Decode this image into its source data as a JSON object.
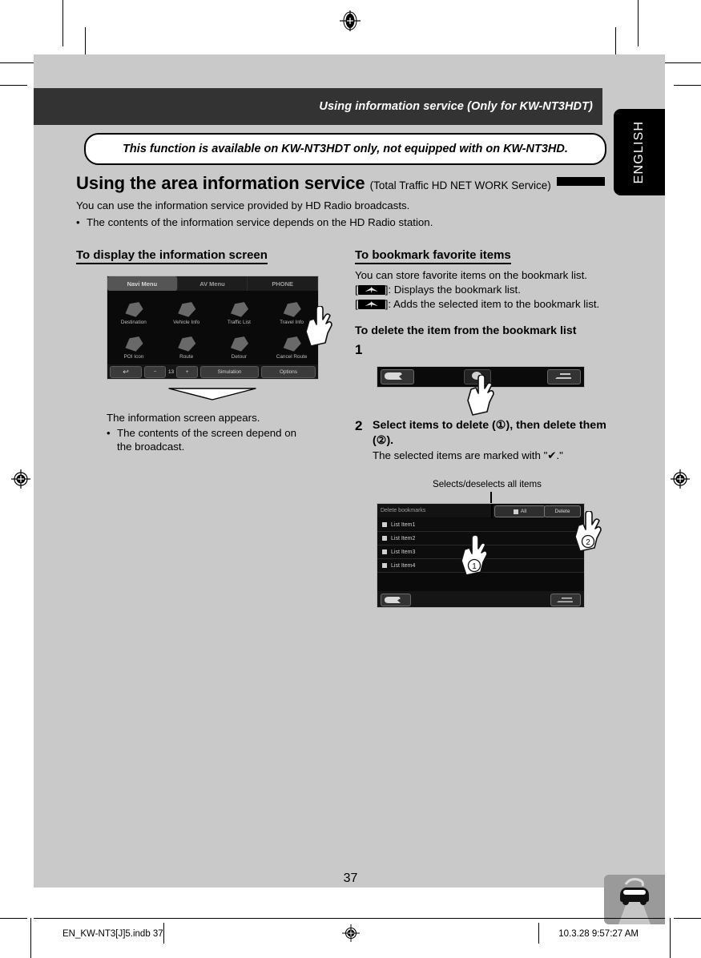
{
  "header": {
    "title": "Using information service (Only for KW-NT3HDT)",
    "side_tab": "ENGLISH"
  },
  "notice": "This function is available on KW-NT3HDT only, not equipped with on KW-NT3HD.",
  "section": {
    "title": "Using the area information service",
    "subtitle": "(Total Traffic HD NET WORK Service)"
  },
  "intro": {
    "line1": "You can use the information service provided by HD Radio broadcasts.",
    "bullet_dot": "•",
    "bullet1": "The contents of the information service depends on the HD Radio station."
  },
  "left_column": {
    "heading": "To display the information screen",
    "caption": "The information screen appears.",
    "bullet_dot": "•",
    "bullet": "The contents of the screen depend on the broadcast.",
    "navi_screen": {
      "tabs": [
        {
          "label": "Navi Menu",
          "active": true
        },
        {
          "label": "AV Menu",
          "active": false
        },
        {
          "label": "PHONE",
          "active": false
        }
      ],
      "items": [
        "Destination",
        "Vehicle Info",
        "Traffic List",
        "Travel Info",
        "POI Icon",
        "Route",
        "Detour",
        "Cancel Route"
      ],
      "bottom": {
        "back": "↩",
        "zoom_out": "−",
        "scale": "13",
        "zoom_in": "+",
        "simulation": "Simulation",
        "options": "Options"
      }
    }
  },
  "right_column": {
    "heading": "To bookmark favorite items",
    "line1": "You can store favorite items on the bookmark list.",
    "icon_line1_prefix": "[",
    "icon_line1_suffix": "]: Displays the bookmark list.",
    "icon_line2_prefix": "[",
    "icon_line2_suffix": "]: Adds the selected item to the bookmark list.",
    "delete_heading": "To delete the item from the bookmark list",
    "step1_no": "1",
    "step2_no": "2",
    "step2_text": "Select items to delete (①), then delete them (②).",
    "step2_sub": "The selected items are marked with \"✔.\"",
    "callout": "Selects/deselects all items",
    "marker1": "①",
    "marker2": "②",
    "delete_screen": {
      "title": "Delete bookmarks",
      "all_label": "All",
      "delete_label": "Delete",
      "items": [
        "List Item1",
        "List Item2",
        "List Item3",
        "List Item4"
      ]
    }
  },
  "footer": {
    "page_number": "37",
    "file_label": "EN_KW-NT3[J]5.indb   37",
    "timestamp": "10.3.28   9:57:27 AM"
  },
  "colors": {
    "page_bg": "#c9c9c9",
    "header_bar": "#333333",
    "screen_bg": "#0a0a0a",
    "accent_black": "#000000",
    "car_icon_bg": "#9a9a9a"
  }
}
